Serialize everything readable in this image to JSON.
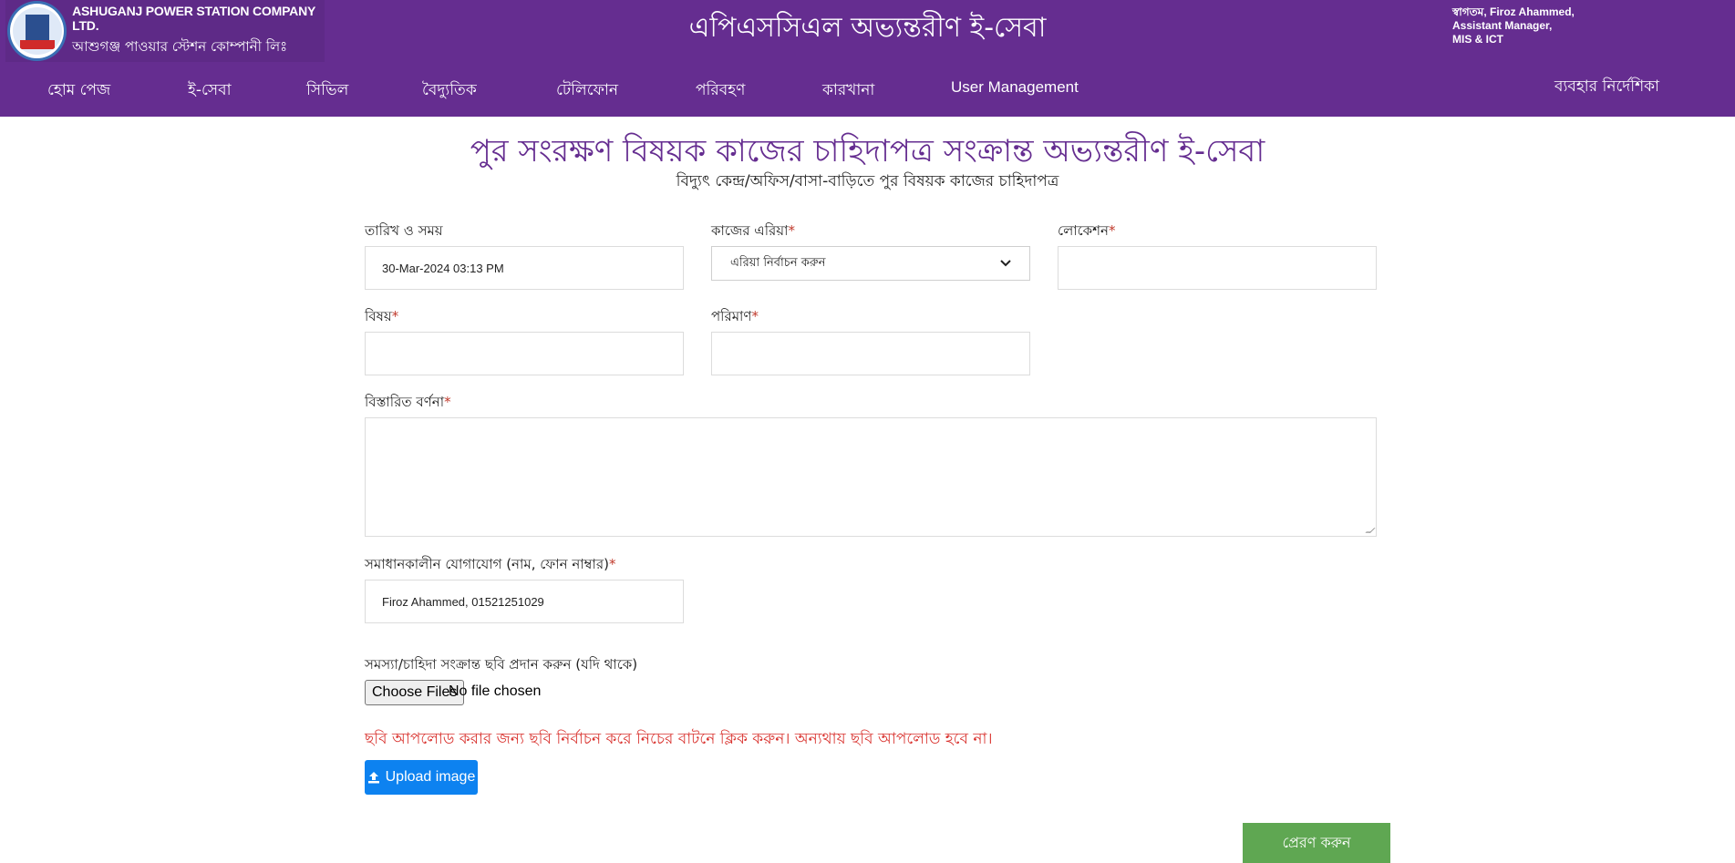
{
  "header": {
    "company_en": "ASHUGANJ POWER STATION COMPANY LTD.",
    "company_bn": "আশুগঞ্জ পাওয়ার স্টেশন কোম্পানী লিঃ",
    "site_title": "এপিএসসিএল অভ্যন্তরীণ ই-সেবা",
    "welcome_line1": "স্বাগতম, Firoz Ahammed,",
    "welcome_line2": "Assistant Manager,",
    "welcome_line3": "MIS & ICT"
  },
  "nav": {
    "items": [
      {
        "label": "হোম পেজ"
      },
      {
        "label": "ই-সেবা"
      },
      {
        "label": "সিভিল"
      },
      {
        "label": "বৈদ্যুতিক"
      },
      {
        "label": "টেলিফোন"
      },
      {
        "label": "পরিবহণ"
      },
      {
        "label": "কারখানা"
      },
      {
        "label": "User Management"
      }
    ],
    "guide": "ব্যবহার নির্দেশিকা"
  },
  "page": {
    "title": "পুর সংরক্ষণ বিষয়ক কাজের চাহিদাপত্র সংক্রান্ত অভ্যন্তরীণ ই-সেবা",
    "subtitle": "বিদ্যুৎ কেন্দ্র/অফিস/বাসা-বাড়িতে পুর বিষয়ক কাজের চাহিদাপত্র"
  },
  "form": {
    "datetime_label": "তারিখ ও সময়",
    "datetime_value": "30-Mar-2024 03:13 PM",
    "area_label": "কাজের এরিয়া",
    "area_selected": "এরিয়া নির্বাচন করুন",
    "location_label": "লোকেশন",
    "location_value": "",
    "subject_label": "বিষয়",
    "subject_value": "",
    "quantity_label": "পরিমাণ",
    "quantity_value": "",
    "description_label": "বিস্তারিত বর্ণনা",
    "contact_label": "সমাধানকালীন যোগাযোগ (নাম, ফোন নাম্বার)",
    "contact_value": "Firoz Ahammed, 01521251029",
    "image_label": "সমস্যা/চাহিদা সংক্রান্ত ছবি প্রদান করুন (যদি থাকে)",
    "choose_files": "Choose Files",
    "no_file": "No file chosen",
    "warning": "ছবি আপলোড করার জন্য ছবি নির্বাচন করে নিচের বাটনে ক্লিক করুন। অন্যথায় ছবি আপলোড হবে না।",
    "upload_label": "Upload image",
    "submit_label": "প্রেরণ করুন",
    "required_mark": "*"
  },
  "colors": {
    "brand": "#652d90",
    "upload": "#0d82f0",
    "submit": "#5fa752",
    "warning": "#d9332f"
  }
}
